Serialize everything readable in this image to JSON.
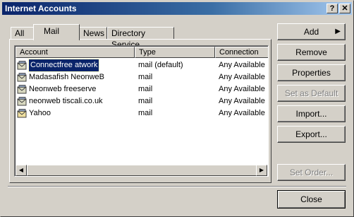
{
  "window": {
    "title": "Internet Accounts",
    "help_label": "?",
    "close_label": "✕"
  },
  "tabs": [
    {
      "label": "All"
    },
    {
      "label": "Mail",
      "active": true
    },
    {
      "label": "News"
    },
    {
      "label": "Directory Service"
    }
  ],
  "table": {
    "columns": [
      "Account",
      "Type",
      "Connection"
    ],
    "rows": [
      {
        "icon": "mail-account-icon",
        "account": "Connectfree atwork",
        "type": "mail (default)",
        "connection": "Any Available",
        "selected": true
      },
      {
        "icon": "mail-account-icon",
        "account": "Madasafish NeonweB",
        "type": "mail",
        "connection": "Any Available"
      },
      {
        "icon": "mail-account-icon",
        "account": "Neonweb freeserve",
        "type": "mail",
        "connection": "Any Available"
      },
      {
        "icon": "mail-account-icon",
        "account": "neonweb tiscali.co.uk",
        "type": "mail",
        "connection": "Any Available"
      },
      {
        "icon": "mail-account-icon",
        "account": "Yahoo",
        "type": "mail",
        "connection": "Any Available"
      }
    ]
  },
  "buttons": {
    "add": "Add",
    "remove": "Remove",
    "properties": "Properties",
    "set_default": "Set as Default",
    "import": "Import...",
    "export": "Export...",
    "set_order": "Set Order...",
    "close": "Close"
  },
  "colors": {
    "title_bar": "#0a246a",
    "selection": "#0a246a",
    "face": "#d4d0c8"
  }
}
